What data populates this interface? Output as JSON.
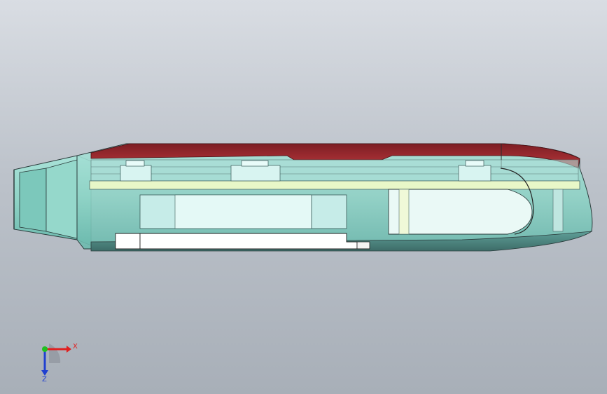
{
  "colors": {
    "shell": "#8fd3c6",
    "shell_stroke": "#2b3b3b",
    "cover": "#a32a2f",
    "inner_light": "#dff7f4",
    "inner_mid": "#bfeae4",
    "yellow_tint": "#eef7c8",
    "axis_x": "#e02020",
    "axis_y": "#20a020",
    "axis_z": "#2040d0"
  },
  "triad": {
    "x_label": "X",
    "z_label": "Z"
  }
}
